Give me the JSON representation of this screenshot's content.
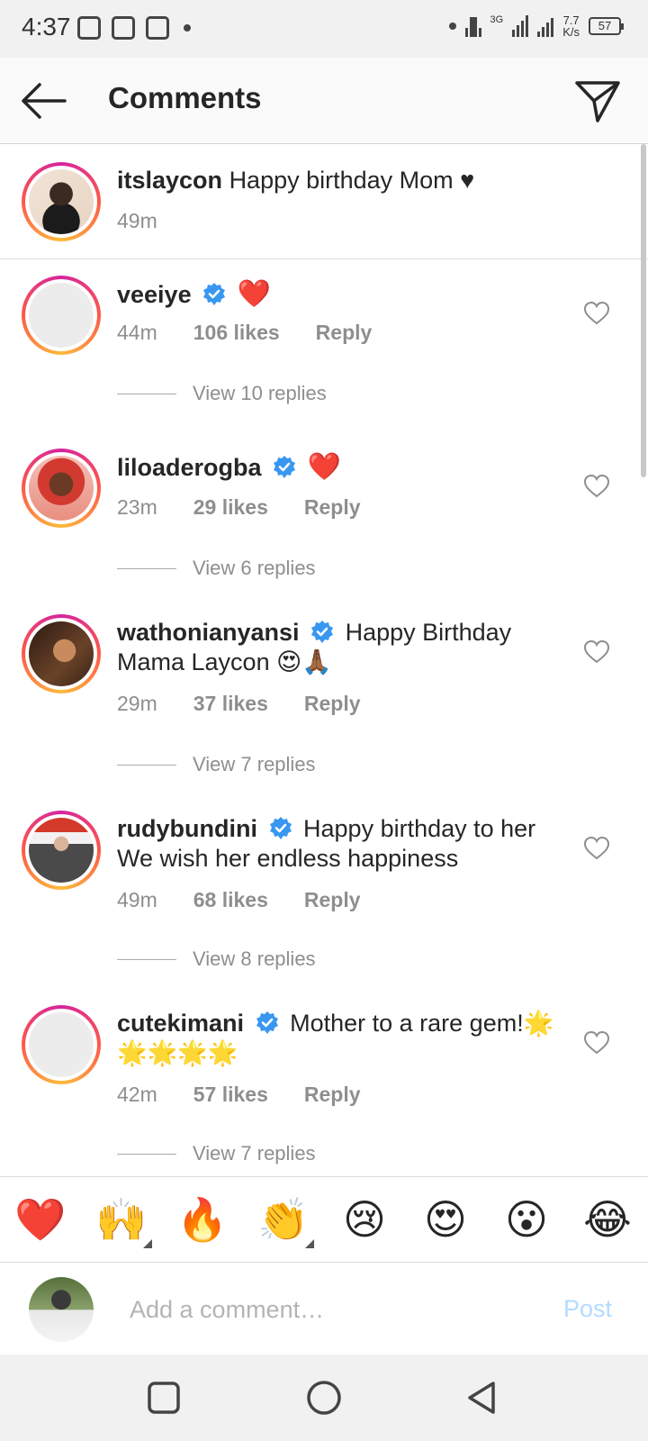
{
  "status_bar": {
    "time": "4:37",
    "net_speed_value": "7.7",
    "net_speed_unit": "K/s",
    "battery": "57",
    "network_label": "3G"
  },
  "header": {
    "title": "Comments",
    "back_icon": "arrow-left-icon",
    "direct_icon": "paper-plane-icon"
  },
  "caption": {
    "username": "itslaycon",
    "text": "Happy birthday Mom ♥",
    "time": "49m"
  },
  "comments": [
    {
      "username": "veeiye",
      "verified": true,
      "text": "❤️",
      "time": "44m",
      "likes": "106 likes",
      "reply": "Reply",
      "view_replies": "View 10 replies"
    },
    {
      "username": "liloaderogba",
      "verified": true,
      "text": "❤️",
      "time": "23m",
      "likes": "29 likes",
      "reply": "Reply",
      "view_replies": "View 6 replies"
    },
    {
      "username": "wathonianyansi",
      "verified": true,
      "text": "Happy Birthday Mama Laycon 😍🙏🏾",
      "time": "29m",
      "likes": "37 likes",
      "reply": "Reply",
      "view_replies": "View 7 replies"
    },
    {
      "username": "rudybundini",
      "verified": true,
      "text": "Happy birthday to her We wish her endless happiness",
      "time": "49m",
      "likes": "68 likes",
      "reply": "Reply",
      "view_replies": "View 8 replies"
    },
    {
      "username": "cutekimani",
      "verified": true,
      "text": "Mother to a rare gem!🌟🌟🌟🌟🌟",
      "time": "42m",
      "likes": "57 likes",
      "reply": "Reply",
      "view_replies": "View 7 replies"
    }
  ],
  "emoji_bar": [
    "❤️",
    "🙌",
    "🔥",
    "👏",
    "😢",
    "😍",
    "😮",
    "😂"
  ],
  "comment_input": {
    "placeholder": "Add a comment…",
    "post_label": "Post"
  },
  "colors": {
    "verified_blue": "#3897f0",
    "post_disabled": "#b3dbff",
    "meta_gray": "#8e8e8e"
  }
}
